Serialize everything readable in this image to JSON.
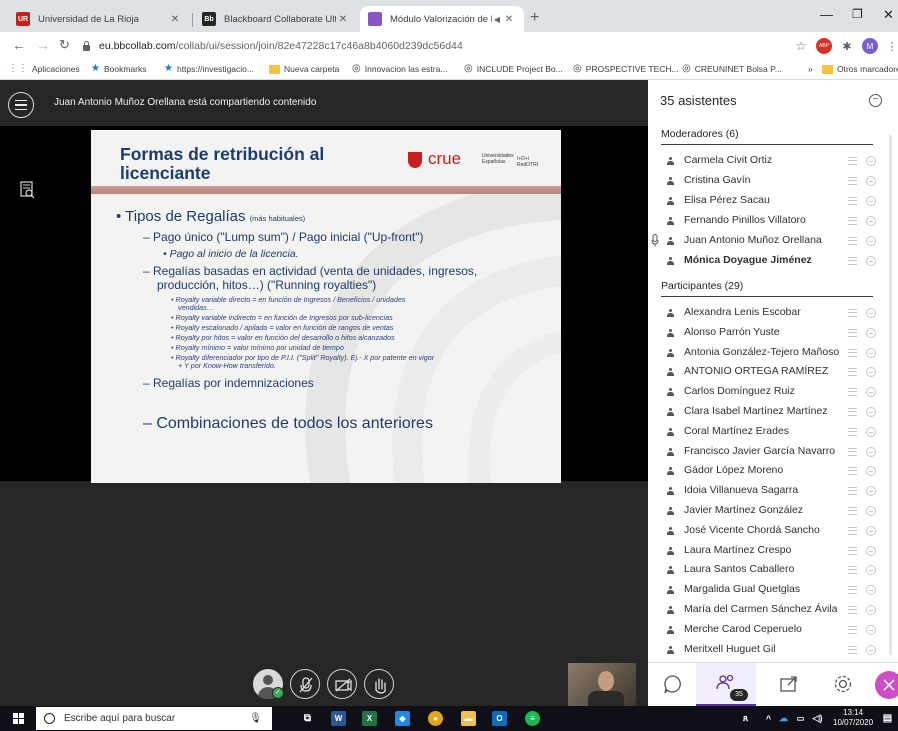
{
  "browser": {
    "tabs": [
      {
        "title": "Universidad de La Rioja",
        "favicon": "UR",
        "color": "#c8201e"
      },
      {
        "title": "Blackboard Collaborate Ultra – I",
        "favicon": "Bb",
        "color": "#262626"
      },
      {
        "title": "Módulo Valorización de Resu",
        "favicon": "",
        "color": "#8a56c4",
        "active": true
      }
    ],
    "url_host": "eu.bbcollab.com",
    "url_path": "/collab/ui/session/join/82e47228c17c46a8b4060d239dc56d44",
    "profile_initial": "M",
    "bookmarks": [
      "Aplicaciones",
      "Bookmarks",
      "https://investigacio...",
      "Nueva carpeta",
      "Innovacion las estra...",
      "INCLUDE Project Bo...",
      "PROSPECTIVE TECH...",
      "CREUNINET Bolsa P...",
      "»",
      "Otros marcadores"
    ]
  },
  "session": {
    "sharing_text": "Juan Antonio Muñoz Orellana está compartiendo contenido"
  },
  "slide": {
    "title": "Formas de retribución al licenciante",
    "logo_word": "crue",
    "logo_sub": "Universidades Españolas",
    "logo_idi": "I+D+i RedOTRI",
    "bullet1": "Tipos de Regalías",
    "bullet1_note": "(más habituales)",
    "b2_1": "Pago único (\"Lump sum\") / Pago inicial (\"Up-front\")",
    "b3_1": "Pago al inicio de la licencia.",
    "b2_2a": "Regalías basadas en actividad (venta de unidades, ingresos,",
    "b2_2b": "producción, hitos…) (\"Running royalties\")",
    "b4": [
      "Royalty variable directo =  en función de Ingresos / Beneficios  / unidades",
      "vendidas…",
      "Royalty variable indirecto = en función de Ingresos por sub-licencias",
      "Royalty escalonado / apilado = valor en función de rangos de ventas",
      "Royalty por hitos  = valor en función del desarrollo o hitos alcanzados",
      "Royalty mínimo = valor mínimo por unidad de tiempo",
      "Royalty diferenciador por tipo de P.I.I. (\"Split\" Royalty). Ej.- X por patente en vigor",
      "+ Y por Know-How transferido."
    ],
    "b2_3": "Regalías por indemnizaciones",
    "b2_4": "Combinaciones de todos los anteriores"
  },
  "panel": {
    "attendee_count": "35 asistentes",
    "moderators_title": "Moderadores (6)",
    "moderators": [
      {
        "name": "Carmela Civit Ortiz"
      },
      {
        "name": "Cristina Gavín"
      },
      {
        "name": "Elisa Pérez Sacau"
      },
      {
        "name": "Fernando Pinillos Villatoro"
      },
      {
        "name": "Juan Antonio Muñoz Orellana",
        "mic": true
      },
      {
        "name": "Mónica Doyague Jiménez",
        "bold": true
      }
    ],
    "participants_title": "Participantes (29)",
    "participants": [
      "Alexandra Lenis Escobar",
      "Alonso Parrón Yuste",
      "Antonia González-Tejero Mañoso",
      "ANTONIO ORTEGA RAMÍREZ",
      "Carlos Domínguez Ruiz",
      "Clara Isabel Martínez Martínez",
      "Coral Martínez Erades",
      "Francisco Javier García Navarro",
      "Gádor López Moreno",
      "Idoia Villanueva Sagarra",
      "Javier Martínez González",
      "José Vicente Chordá Sancho",
      "Laura Martínez Crespo",
      "Laura Santos Caballero",
      "Margalida Gual Quetglas",
      "María del Carmen Sánchez Ávila",
      "Merche Carod Ceperuelo",
      "Meritxell Huguet Gil"
    ],
    "people_badge": "35"
  },
  "taskbar": {
    "search_placeholder": "Escribe aquí para buscar",
    "time": "13:14",
    "date": "10/07/2020"
  },
  "colors": {
    "accent": "#5a2ca0",
    "close": "#cc4dc6",
    "slide_title": "#1c3c6e",
    "crue_red": "#c8201e"
  }
}
